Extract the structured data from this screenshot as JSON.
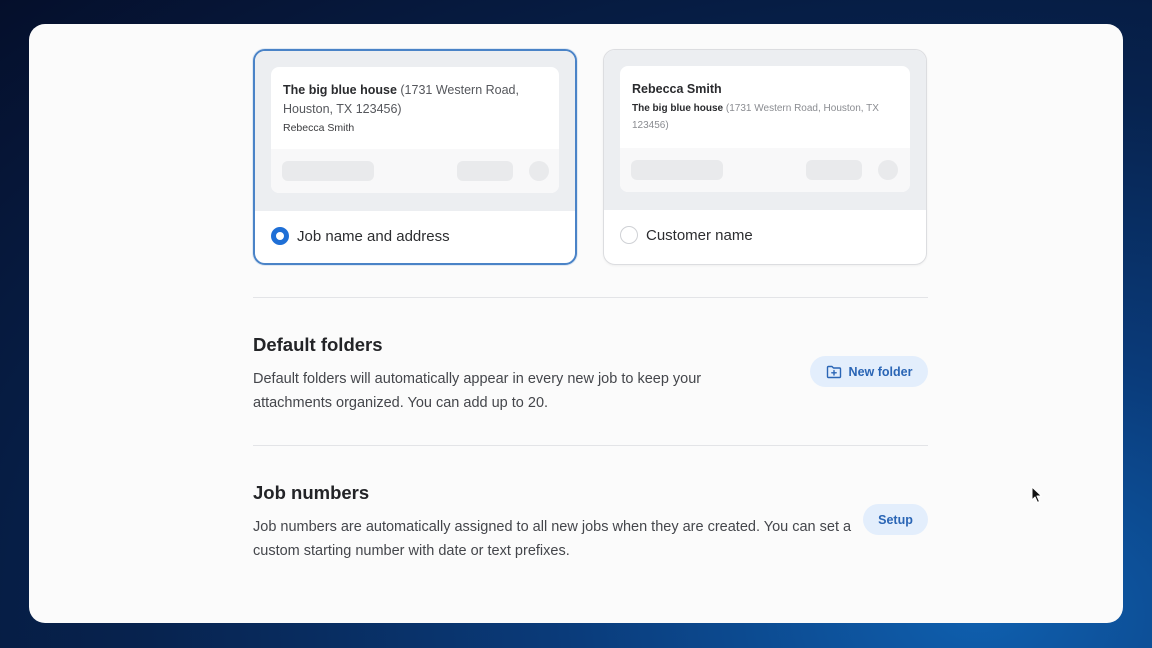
{
  "naming_options": [
    {
      "preview_title": "The big blue house",
      "preview_address": "(1731 Western Road, Houston, TX 123456)",
      "preview_person": "Rebecca Smith",
      "label": "Job name and address",
      "selected": true
    },
    {
      "preview_title": "Rebecca Smith",
      "preview_job": "The big blue house",
      "preview_address": "(1731 Western Road, Houston, TX 123456)",
      "label": "Customer name",
      "selected": false
    }
  ],
  "default_folders": {
    "title": "Default folders",
    "description": "Default folders will automatically appear in every new job to keep your attachments organized. You can add up to 20.",
    "button_label": "New folder",
    "button_icon": "folder-plus-icon"
  },
  "job_numbers": {
    "title": "Job numbers",
    "description": "Job numbers are automatically assigned to all new jobs when they are created. You can set a custom starting number with date or text prefixes.",
    "button_label": "Setup"
  },
  "colors": {
    "accent": "#1f6fd6",
    "selected_border": "#4a83c7",
    "pill_bg": "#e3eefc",
    "pill_text": "#2a65b5"
  }
}
